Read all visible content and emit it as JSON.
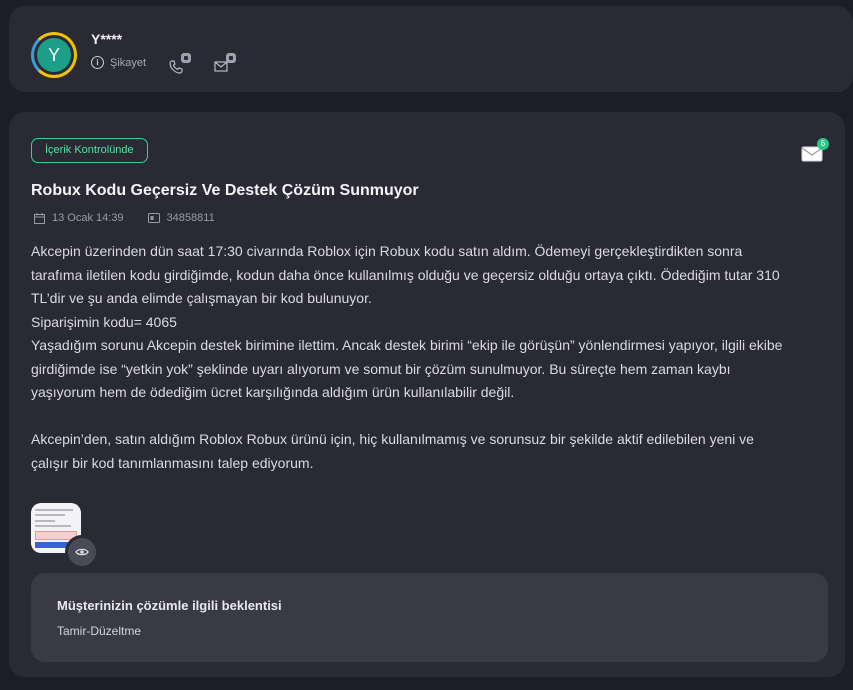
{
  "user": {
    "avatar_letter": "Y",
    "name": "Y****",
    "complaint_label": "Şikayet",
    "ring_colors": [
      "#f2c200",
      "#3d9bd8"
    ],
    "avatar_color": "#1b9f88"
  },
  "complaint": {
    "status": "İçerik Kontrolünde",
    "status_color": "#3ecf8e",
    "message_count": "6",
    "title": "Robux Kodu Geçersiz Ve Destek Çözüm Sunmuyor",
    "date": "13 Ocak 14:39",
    "id": "34858811",
    "body": [
      "Akcepin üzerinden dün saat 17:30 civarında Roblox için Robux kodu satın aldım. Ödemeyi gerçekleştirdikten sonra tarafıma iletilen kodu girdiğimde, kodun daha önce kullanılmış olduğu ve geçersiz olduğu ortaya çıktı. Ödediğim tutar 310 TL’dir ve şu anda elimde çalışmayan bir kod bulunuyor.",
      "Siparişimin kodu= 4065",
      "Yaşadığım sorunu Akcepin destek birimine ilettim. Ancak destek birimi “ekip ile görüşün” yönlendirmesi yapıyor, ilgili ekibe girdiğimde ise “yetkin yok” şeklinde uyarı alıyorum ve somut bir çözüm sunulmuyor. Bu süreçte hem zaman kaybı yaşıyorum hem de ödediğim ücret karşılığında aldığım ürün kullanılabilir değil.",
      "Akcepin’den, satın aldığım Roblox Robux ürünü için, hiç kullanılmamış ve sorunsuz bir şekilde aktif edilebilen yeni ve çalışır bir kod tanımlanmasını talep ediyorum."
    ],
    "expectation_title": "Müşterinizin çözümle ilgili beklentisi",
    "expectation_value": "Tamir-Düzeltme"
  },
  "icons": {
    "info": "info-icon",
    "phone": "phone-icon",
    "mail": "mail-icon",
    "lock": "lock-icon",
    "calendar": "calendar-icon",
    "id": "id-card-icon",
    "eye": "eye-icon"
  }
}
